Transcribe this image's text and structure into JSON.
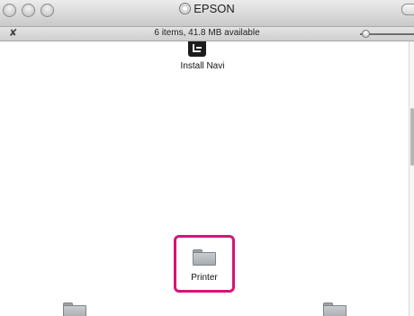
{
  "window": {
    "title": "EPSON",
    "title_icon": "disk-icon"
  },
  "statusbar": {
    "text": "6 items, 41.8 MB available",
    "left_icon": "pin-icon"
  },
  "items": [
    {
      "label": "Install Navi",
      "icon": "install-navi-icon"
    },
    {
      "label": "Printer",
      "icon": "folder-icon",
      "highlighted": true
    }
  ],
  "colors": {
    "highlight": "#d9127a"
  }
}
